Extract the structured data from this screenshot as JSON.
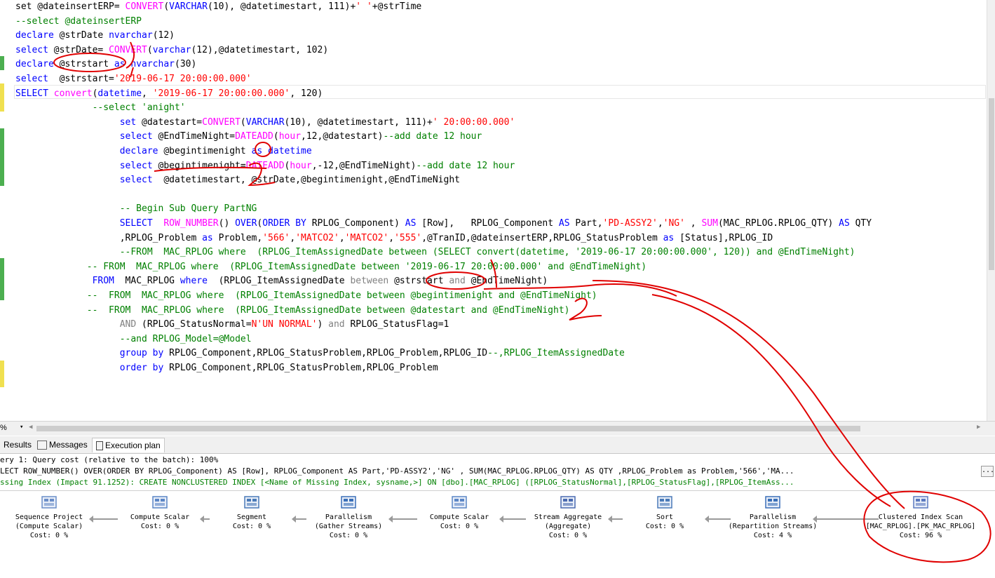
{
  "editor": {
    "lines": [
      [
        [
          "set @dateinsertERP= ",
          ""
        ],
        [
          "CONVERT",
          "fn"
        ],
        [
          "(",
          ""
        ],
        [
          "VARCHAR",
          "kw"
        ],
        [
          "(10), @datetimestart, 111)+",
          ""
        ],
        [
          "' '",
          "str"
        ],
        [
          "+@strTime",
          ""
        ]
      ],
      [
        [
          "--select @dateinsertERP",
          "cm"
        ]
      ],
      [
        [
          "declare",
          "kw"
        ],
        [
          " @strDate ",
          ""
        ],
        [
          "nvarchar",
          "kw"
        ],
        [
          "(12)",
          ""
        ]
      ],
      [
        [
          "select",
          "kw"
        ],
        [
          " @strDate= ",
          ""
        ],
        [
          "CONVERT",
          "fn"
        ],
        [
          "(",
          ""
        ],
        [
          "varchar",
          "kw"
        ],
        [
          "(12),@datetimestart, 102)",
          ""
        ]
      ],
      [
        [
          "declare",
          "kw"
        ],
        [
          " @strstart ",
          ""
        ],
        [
          "as",
          "kw"
        ],
        [
          " ",
          ""
        ],
        [
          "nvarchar",
          "kw"
        ],
        [
          "(30)",
          ""
        ]
      ],
      [
        [
          "select",
          "kw"
        ],
        [
          "  @strstart=",
          ""
        ],
        [
          "'2019-06-17 20:00:00.000'",
          "str"
        ]
      ],
      [
        [
          "SELECT",
          "kw"
        ],
        [
          " ",
          ""
        ],
        [
          "convert",
          "fn"
        ],
        [
          "(",
          ""
        ],
        [
          "datetime",
          "kw"
        ],
        [
          ", ",
          ""
        ],
        [
          "'2019-06-17 20:00:00.000'",
          "str"
        ],
        [
          ", 120)",
          ""
        ]
      ],
      [
        [
          "              --select 'anight'",
          "cm"
        ]
      ],
      [
        [
          "                   ",
          ""
        ],
        [
          "set",
          "kw"
        ],
        [
          " @datestart=",
          ""
        ],
        [
          "CONVERT",
          "fn"
        ],
        [
          "(",
          ""
        ],
        [
          "VARCHAR",
          "kw"
        ],
        [
          "(10), @datetimestart, 111)+",
          ""
        ],
        [
          "' 20:00:00.000'",
          "str"
        ]
      ],
      [
        [
          "                   ",
          ""
        ],
        [
          "select",
          "kw"
        ],
        [
          " @EndTimeNight=",
          ""
        ],
        [
          "DATEADD",
          "fn"
        ],
        [
          "(",
          ""
        ],
        [
          "hour",
          "fn"
        ],
        [
          ",12,@datestart)",
          ""
        ],
        [
          "--add date 12 hour",
          "cm"
        ]
      ],
      [
        [
          "                   ",
          ""
        ],
        [
          "declare",
          "kw"
        ],
        [
          " @begintimenight ",
          ""
        ],
        [
          "as",
          "kw"
        ],
        [
          " ",
          ""
        ],
        [
          "datetime",
          "kw"
        ]
      ],
      [
        [
          "                   ",
          ""
        ],
        [
          "select",
          "kw"
        ],
        [
          " @begintimenight=",
          ""
        ],
        [
          "DATEADD",
          "fn"
        ],
        [
          "(",
          ""
        ],
        [
          "hour",
          "fn"
        ],
        [
          ",-12,@EndTimeNight)",
          ""
        ],
        [
          "--add date 12 hour",
          "cm"
        ]
      ],
      [
        [
          "                   ",
          ""
        ],
        [
          "select",
          "kw"
        ],
        [
          "  @datetimestart, @strDate,@begintimenight,@EndTimeNight",
          ""
        ]
      ],
      [
        [
          "",
          ""
        ]
      ],
      [
        [
          "                   -- Begin Sub Query PartNG",
          "cm"
        ]
      ],
      [
        [
          "                   ",
          ""
        ],
        [
          "SELECT",
          "kw"
        ],
        [
          "  ",
          ""
        ],
        [
          "ROW_NUMBER",
          "fn"
        ],
        [
          "() ",
          ""
        ],
        [
          "OVER",
          "kw"
        ],
        [
          "(",
          ""
        ],
        [
          "ORDER BY",
          "kw"
        ],
        [
          " RPLOG_Component) ",
          ""
        ],
        [
          "AS",
          "kw"
        ],
        [
          " [Row],   RPLOG_Component ",
          ""
        ],
        [
          "AS",
          "kw"
        ],
        [
          " Part,",
          ""
        ],
        [
          "'PD-ASSY2'",
          "str"
        ],
        [
          ",",
          ""
        ],
        [
          "'NG'",
          "str"
        ],
        [
          " , ",
          ""
        ],
        [
          "SUM",
          "fn"
        ],
        [
          "(MAC_RPLOG.RPLOG_QTY) ",
          ""
        ],
        [
          "AS",
          "kw"
        ],
        [
          " QTY",
          ""
        ]
      ],
      [
        [
          "                   ,RPLOG_Problem ",
          ""
        ],
        [
          "as",
          "kw"
        ],
        [
          " Problem,",
          ""
        ],
        [
          "'566'",
          "str"
        ],
        [
          ",",
          ""
        ],
        [
          "'MATCO2'",
          "str"
        ],
        [
          ",",
          ""
        ],
        [
          "'MATCO2'",
          "str"
        ],
        [
          ",",
          ""
        ],
        [
          "'555'",
          "str"
        ],
        [
          ",@TranID,@dateinsertERP,RPLOG_StatusProblem ",
          ""
        ],
        [
          "as",
          "kw"
        ],
        [
          " [Status],RPLOG_ID",
          ""
        ]
      ],
      [
        [
          "                   --FROM  MAC_RPLOG where  (RPLOG_ItemAssignedDate between (SELECT convert(datetime, '2019-06-17 20:00:00.000', 120)) and @EndTimeNight)",
          "cm"
        ]
      ],
      [
        [
          "             -- FROM  MAC_RPLOG where  (RPLOG_ItemAssignedDate between '2019-06-17 20:00:00.000' and @EndTimeNight)",
          "cm"
        ]
      ],
      [
        [
          "              ",
          ""
        ],
        [
          "FROM",
          "kw"
        ],
        [
          "  MAC_RPLOG ",
          ""
        ],
        [
          "where",
          "kw"
        ],
        [
          "  (RPLOG_ItemAssignedDate ",
          ""
        ],
        [
          "between",
          "gr"
        ],
        [
          " @strstart ",
          ""
        ],
        [
          "and",
          "gr"
        ],
        [
          " @EndTimeNight)",
          ""
        ]
      ],
      [
        [
          "             --  FROM  MAC_RPLOG where  (RPLOG_ItemAssignedDate between @begintimenight and @EndTimeNight)",
          "cm"
        ]
      ],
      [
        [
          "             --  FROM  MAC_RPLOG where  (RPLOG_ItemAssignedDate between @datestart and @EndTimeNight)",
          "cm"
        ]
      ],
      [
        [
          "                   ",
          ""
        ],
        [
          "AND",
          "gr"
        ],
        [
          " (RPLOG_StatusNormal=",
          ""
        ],
        [
          "N'UN NORMAL'",
          "str"
        ],
        [
          ") ",
          ""
        ],
        [
          "and",
          "gr"
        ],
        [
          " RPLOG_StatusFlag=1",
          ""
        ]
      ],
      [
        [
          "                   --and RPLOG_Model=@Model",
          "cm"
        ]
      ],
      [
        [
          "                   ",
          ""
        ],
        [
          "group by",
          "kw"
        ],
        [
          " RPLOG_Component,RPLOG_StatusProblem,RPLOG_Problem,RPLOG_ID",
          ""
        ],
        [
          "--,RPLOG_ItemAssignedDate",
          "cm"
        ]
      ],
      [
        [
          "                   ",
          ""
        ],
        [
          "order by",
          "kw"
        ],
        [
          " RPLOG_Component,RPLOG_StatusProblem,RPLOG_Problem",
          ""
        ]
      ]
    ]
  },
  "zoom": "%",
  "tabs": {
    "results": "Results",
    "messages": "Messages",
    "execution_plan": "Execution plan"
  },
  "plan": {
    "query_cost": "ery 1: Query cost (relative to the batch): 100%",
    "query_text": "LECT ROW_NUMBER() OVER(ORDER BY RPLOG_Component) AS [Row], RPLOG_Component AS Part,'PD-ASSY2','NG' , SUM(MAC_RPLOG.RPLOG_QTY) AS QTY ,RPLOG_Problem as Problem,'566','MA...",
    "missing_index": "ssing Index (Impact 91.1252): CREATE NONCLUSTERED INDEX [<Name of Missing Index, sysname,>] ON [dbo].[MAC_RPLOG] ([RPLOG_StatusNormal],[RPLOG_StatusFlag],[RPLOG_ItemAss...",
    "more_button": "...",
    "operators": [
      {
        "name": "Sequence Project",
        "sub": "(Compute Scalar)",
        "cost": "Cost: 0 %",
        "icon": "sequence-project-icon"
      },
      {
        "name": "Compute Scalar",
        "sub": "",
        "cost": "Cost: 0 %",
        "icon": "compute-scalar-icon"
      },
      {
        "name": "Segment",
        "sub": "",
        "cost": "Cost: 0 %",
        "icon": "segment-icon"
      },
      {
        "name": "Parallelism",
        "sub": "(Gather Streams)",
        "cost": "Cost: 0 %",
        "icon": "parallelism-icon"
      },
      {
        "name": "Compute Scalar",
        "sub": "",
        "cost": "Cost: 0 %",
        "icon": "compute-scalar-icon"
      },
      {
        "name": "Stream Aggregate",
        "sub": "(Aggregate)",
        "cost": "Cost: 0 %",
        "icon": "stream-aggregate-icon"
      },
      {
        "name": "Sort",
        "sub": "",
        "cost": "Cost: 0 %",
        "icon": "sort-icon"
      },
      {
        "name": "Parallelism",
        "sub": "(Repartition Streams)",
        "cost": "Cost: 4 %",
        "icon": "parallelism-icon"
      },
      {
        "name": "Clustered Index Scan",
        "sub": "[MAC_RPLOG].[PK_MAC_RPLOG]",
        "cost": "Cost: 96 %",
        "icon": "clustered-index-scan-icon"
      }
    ]
  },
  "annotations": {
    "one": "1",
    "two_a": "2",
    "two_b": "2"
  },
  "colors": {
    "keyword": "#0000ff",
    "function": "#ff00ff",
    "string": "#ff0000",
    "comment": "#008000",
    "annotation": "#e00000",
    "gutter_changed": "#4caf50",
    "gutter_unsaved": "#f0e050"
  }
}
